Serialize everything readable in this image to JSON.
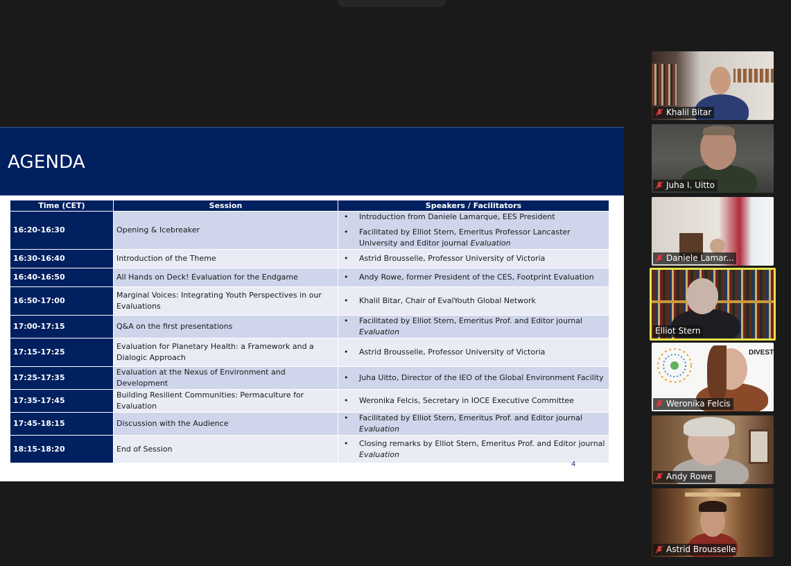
{
  "slide": {
    "title": "AGENDA",
    "page_number": "4",
    "columns": [
      "Time (CET)",
      "Session",
      "Speakers / Facilitators"
    ],
    "rows": [
      {
        "time": "16:20-16:30",
        "session": "Opening & Icebreaker",
        "speakers": [
          {
            "text": "Introduction from Daniele Lamarque, EES President",
            "italic": ""
          },
          {
            "text": "Facilitated by Elliot Stern, Emeritus Professor Lancaster University and Editor journal ",
            "italic": "Evaluation"
          }
        ]
      },
      {
        "time": "16:30-16:40",
        "session": "Introduction of the Theme",
        "speakers": [
          {
            "text": "Astrid Brousselle, Professor University of Victoria",
            "italic": ""
          }
        ]
      },
      {
        "time": "16:40-16:50",
        "session": "All Hands on Deck! Evaluation for the Endgame",
        "speakers": [
          {
            "text": "Andy Rowe, former President of the CES, Footprint Evaluation",
            "italic": ""
          }
        ]
      },
      {
        "time": "16:50-17:00",
        "session": "Marginal Voices: Integrating Youth Perspectives in our Evaluations",
        "speakers": [
          {
            "text": "Khalil Bitar, Chair of EvalYouth Global Network",
            "italic": ""
          }
        ]
      },
      {
        "time": "17:00-17:15",
        "session": "Q&A on the first presentations",
        "speakers": [
          {
            "text": "Facilitated by Elliot Stern, Emeritus Prof. and Editor journal ",
            "italic": "Evaluation"
          }
        ]
      },
      {
        "time": "17:15-17:25",
        "session": "Evaluation for Planetary Health: a Framework and a Dialogic Approach",
        "speakers": [
          {
            "text": "Astrid Brousselle, Professor University of Victoria",
            "italic": ""
          }
        ]
      },
      {
        "time": "17:25-17:35",
        "session": "Evaluation at the Nexus of Environment and Development",
        "speakers": [
          {
            "text": "Juha Uitto, Director of the IEO of the Global Environment Facility",
            "italic": ""
          }
        ]
      },
      {
        "time": "17:35-17:45",
        "session": "Building Resilient Communities: Permaculture for Evaluation",
        "speakers": [
          {
            "text": "Weronika Felcis, Secretary in IOCE Executive Committee",
            "italic": ""
          }
        ]
      },
      {
        "time": "17:45-18:15",
        "session": "Discussion with the Audience",
        "speakers": [
          {
            "text": "Facilitated by Elliot Stern, Emeritus Prof. and Editor journal ",
            "italic": "Evaluation"
          }
        ]
      },
      {
        "time": "18:15-18:20",
        "session": "End of Session",
        "speakers": [
          {
            "text": " Closing remarks by Elliot Stern, Emeritus Prof. and Editor journal ",
            "italic": "Evaluation"
          }
        ]
      }
    ]
  },
  "participants": [
    {
      "name": "Khalil Bitar",
      "muted": true,
      "active": false
    },
    {
      "name": "Juha I. Uitto",
      "muted": true,
      "active": false
    },
    {
      "name": "Daniele Lamar...",
      "muted": true,
      "active": false
    },
    {
      "name": "Elliot Stern",
      "muted": false,
      "active": true
    },
    {
      "name": "Weronika Felcis",
      "muted": true,
      "active": false,
      "overlay_text": "DIVEST"
    },
    {
      "name": "Andy Rowe",
      "muted": true,
      "active": false
    },
    {
      "name": "Astrid Brousselle",
      "muted": true,
      "active": false
    }
  ],
  "colors": {
    "header": "#002060",
    "row_odd": "#cfd5ea",
    "row_even": "#e9ebf5",
    "active_speaker": "#e8e34a",
    "muted_mic": "#e03a3a"
  }
}
